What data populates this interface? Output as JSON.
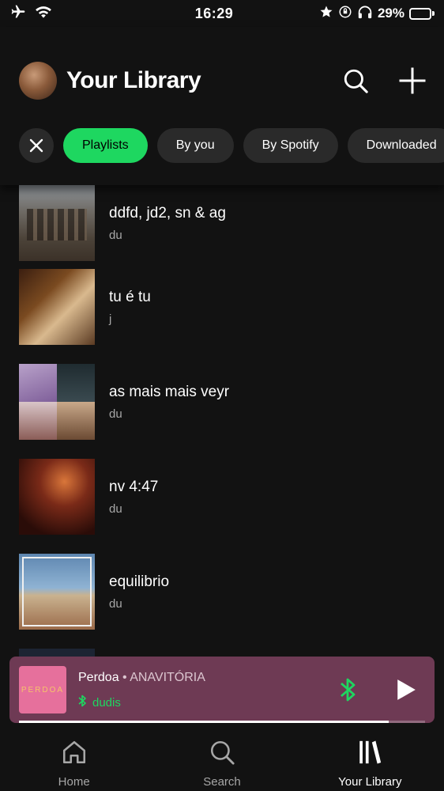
{
  "status_bar": {
    "time": "16:29",
    "battery_percent": "29%",
    "battery_level": 0.29,
    "icons": [
      "airplane-icon",
      "wifi-icon",
      "star-icon",
      "orientation-lock-icon",
      "headphones-icon",
      "battery-charging-icon"
    ]
  },
  "header": {
    "title": "Your Library",
    "search_icon": "search-icon",
    "add_icon": "plus-icon"
  },
  "filters": {
    "close_icon": "close-icon",
    "chips": [
      {
        "label": "Playlists",
        "active": true
      },
      {
        "label": "By you",
        "active": false
      },
      {
        "label": "By Spotify",
        "active": false
      },
      {
        "label": "Downloaded",
        "active": false
      }
    ]
  },
  "playlists": [
    {
      "title": "ddfd, jd2, sn & ag",
      "subtitle": "du"
    },
    {
      "title": "tu é tu",
      "subtitle": "j"
    },
    {
      "title": "as mais mais veyr",
      "subtitle": "du"
    },
    {
      "title": "nv 4:47",
      "subtitle": "du"
    },
    {
      "title": "equilibrio",
      "subtitle": "du"
    }
  ],
  "now_playing": {
    "cover_text": "PERDOA",
    "track": "Perdoa",
    "separator": " • ",
    "artist": "ANAVITÓRIA",
    "device": "dudis",
    "progress": 0.91,
    "colors": {
      "background": "#6e3a54",
      "accent": "#1ed760"
    }
  },
  "bottom_nav": [
    {
      "label": "Home",
      "icon": "home-icon",
      "active": false
    },
    {
      "label": "Search",
      "icon": "search-icon",
      "active": false
    },
    {
      "label": "Your Library",
      "icon": "library-icon",
      "active": true
    }
  ],
  "colors": {
    "accent": "#1ed760",
    "background": "#121212",
    "chip": "#2a2a2a"
  }
}
